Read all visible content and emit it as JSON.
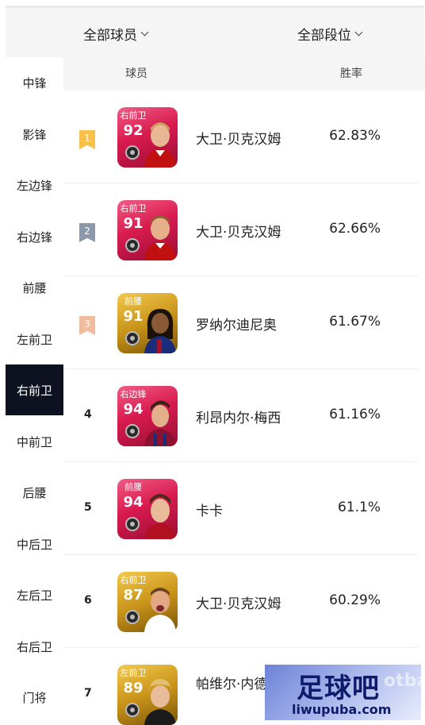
{
  "filters": {
    "players_label": "全部球员",
    "rank_label": "全部段位"
  },
  "sidebar": {
    "items": [
      {
        "label": "中锋"
      },
      {
        "label": "影锋"
      },
      {
        "label": "左边锋"
      },
      {
        "label": "右边锋"
      },
      {
        "label": "前腰"
      },
      {
        "label": "左前卫"
      },
      {
        "label": "右前卫",
        "active": true
      },
      {
        "label": "中前卫"
      },
      {
        "label": "后腰"
      },
      {
        "label": "中后卫"
      },
      {
        "label": "左后卫"
      },
      {
        "label": "右后卫"
      },
      {
        "label": "门将"
      }
    ]
  },
  "table": {
    "col_player": "球员",
    "col_rate": "胜率",
    "rows": [
      {
        "rank": "1",
        "position": "右前卫",
        "rating": "92",
        "name": "大卫·贝克汉姆",
        "rate": "62.83%"
      },
      {
        "rank": "2",
        "position": "右前卫",
        "rating": "91",
        "name": "大卫·贝克汉姆",
        "rate": "62.66%"
      },
      {
        "rank": "3",
        "position": "前腰",
        "rating": "91",
        "name": "罗纳尔迪尼奥",
        "rate": "61.67%"
      },
      {
        "rank": "4",
        "position": "右边锋",
        "rating": "94",
        "name": "利昂内尔·梅西",
        "rate": "61.16%"
      },
      {
        "rank": "5",
        "position": "前腰",
        "rating": "94",
        "name": "卡卡",
        "rate": "61.1%"
      },
      {
        "rank": "6",
        "position": "右前卫",
        "rating": "87",
        "name": "大卫·贝克汉姆",
        "rate": "60.29%"
      },
      {
        "rank": "7",
        "position": "左前卫",
        "rating": "89",
        "name": "帕维尔·内德维德",
        "name_visible": "帕维尔·内德\n德",
        "rate": ""
      }
    ]
  },
  "watermark": {
    "title": "足球吧",
    "url": "liwupuba.com",
    "faint": "otba"
  },
  "colors": {
    "active_tab_bg": "#0e1220",
    "card_pink": "#d81b4f",
    "card_gold": "#c9941a",
    "flag_gold": "#f7c14a",
    "flag_silver": "#8b97aa",
    "flag_bronze": "#efbc9e"
  }
}
